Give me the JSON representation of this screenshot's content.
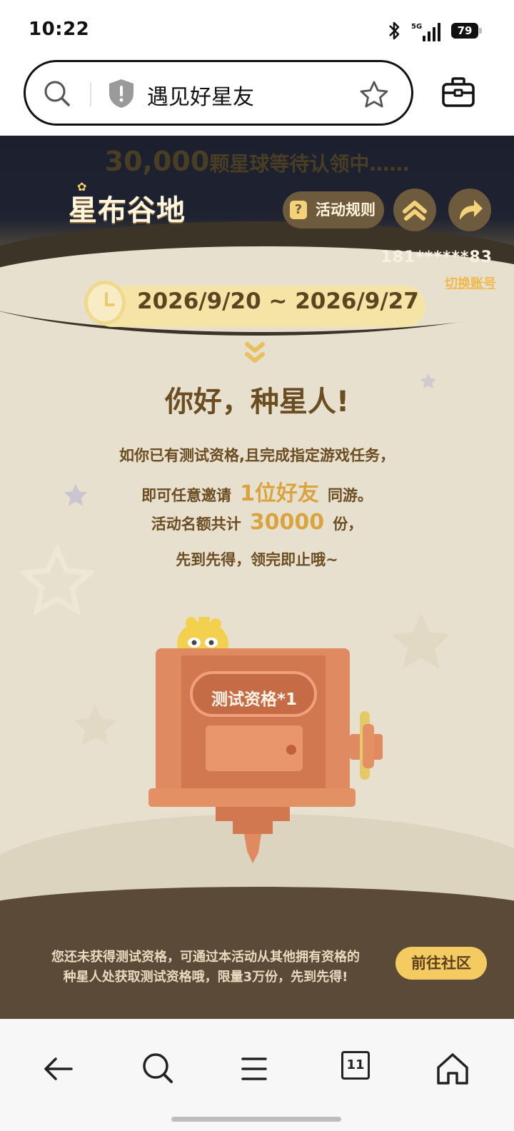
{
  "status": {
    "time": "10:22",
    "network": "5G",
    "battery": "79"
  },
  "browser": {
    "page_title": "遇见好星友",
    "open_tabs": "11"
  },
  "hero": {
    "banner_number": "30,000",
    "banner_text": "颗星球等待认领中……",
    "logo_text": "星布谷地",
    "rules_label": "活动规则",
    "account": "181******83",
    "switch_account": "切换账号",
    "date_range": "2026/9/20 ~ 2026/9/27"
  },
  "main": {
    "greeting": "你好，种星人!",
    "line1": "如你已有测试资格,且完成指定游戏任务，",
    "line2_pre": "即可任意邀请",
    "line2_hl": "1位好友",
    "line2_post": "同游。",
    "line3_pre": "活动名额共计",
    "line3_hl": "30000",
    "line3_post": "份，",
    "line4": "先到先得，领完即止哦~",
    "qualification": "测试资格*1"
  },
  "footer": {
    "text1": "您还未获得测试资格，可通过本活动从其他拥有资格的",
    "text2": "种星人处获取测试资格哦，限量3万份，先到先得!",
    "button": "前往社区"
  },
  "colors": {
    "brown_text": "#6b4d22",
    "gold_highlight": "#d9a440",
    "footer_bg": "#5b4a38",
    "button_yellow": "#f4cb60",
    "page_bg": "#e8e0cf"
  }
}
